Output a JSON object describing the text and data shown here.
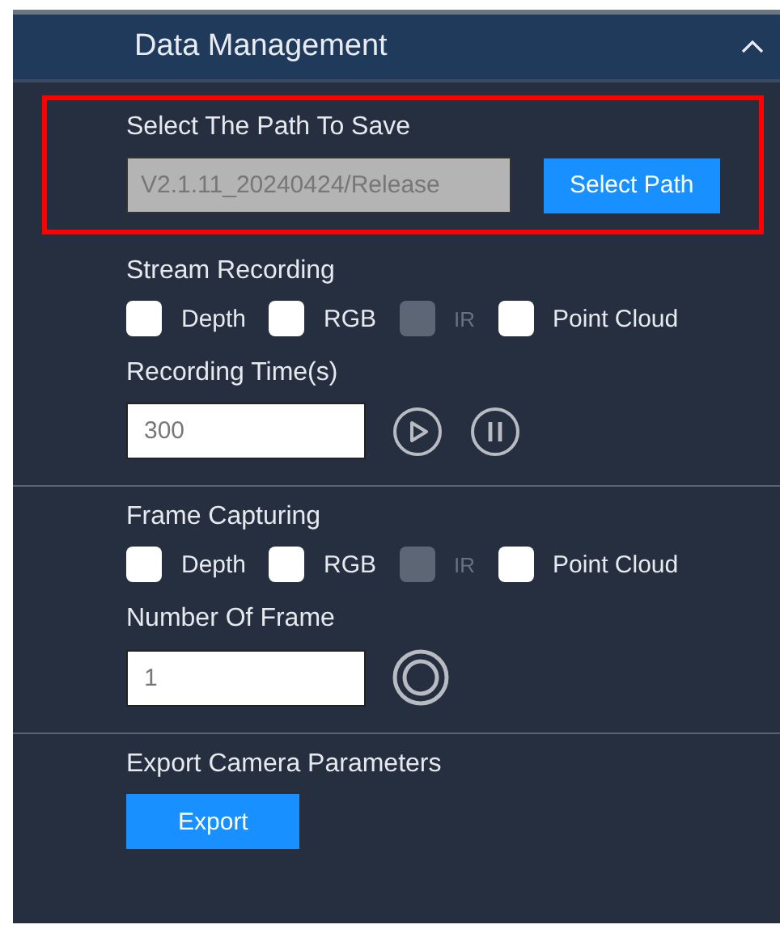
{
  "panel": {
    "title": "Data Management",
    "expanded": true
  },
  "sections": [
    {
      "kind": "path",
      "title": "Select The Path To Save",
      "highlighted": true,
      "path_value": "V2.1.11_20240424/Release",
      "button": "Select Path"
    },
    {
      "kind": "recording",
      "title": "Stream Recording",
      "options": [
        {
          "label": "Depth",
          "checked": false,
          "disabled": false
        },
        {
          "label": "RGB",
          "checked": false,
          "disabled": false
        },
        {
          "label": "IR",
          "checked": false,
          "disabled": true
        },
        {
          "label": "Point Cloud",
          "checked": false,
          "disabled": false
        }
      ],
      "field_label": "Recording Time(s)",
      "field_value": "300"
    },
    {
      "kind": "capture",
      "title": "Frame Capturing",
      "options": [
        {
          "label": "Depth",
          "checked": false,
          "disabled": false
        },
        {
          "label": "RGB",
          "checked": false,
          "disabled": false
        },
        {
          "label": "IR",
          "checked": false,
          "disabled": true
        },
        {
          "label": "Point Cloud",
          "checked": false,
          "disabled": false
        }
      ],
      "field_label": "Number Of Frame",
      "field_value": "1"
    },
    {
      "kind": "export",
      "title": "Export Camera Parameters",
      "button": "Export"
    }
  ]
}
